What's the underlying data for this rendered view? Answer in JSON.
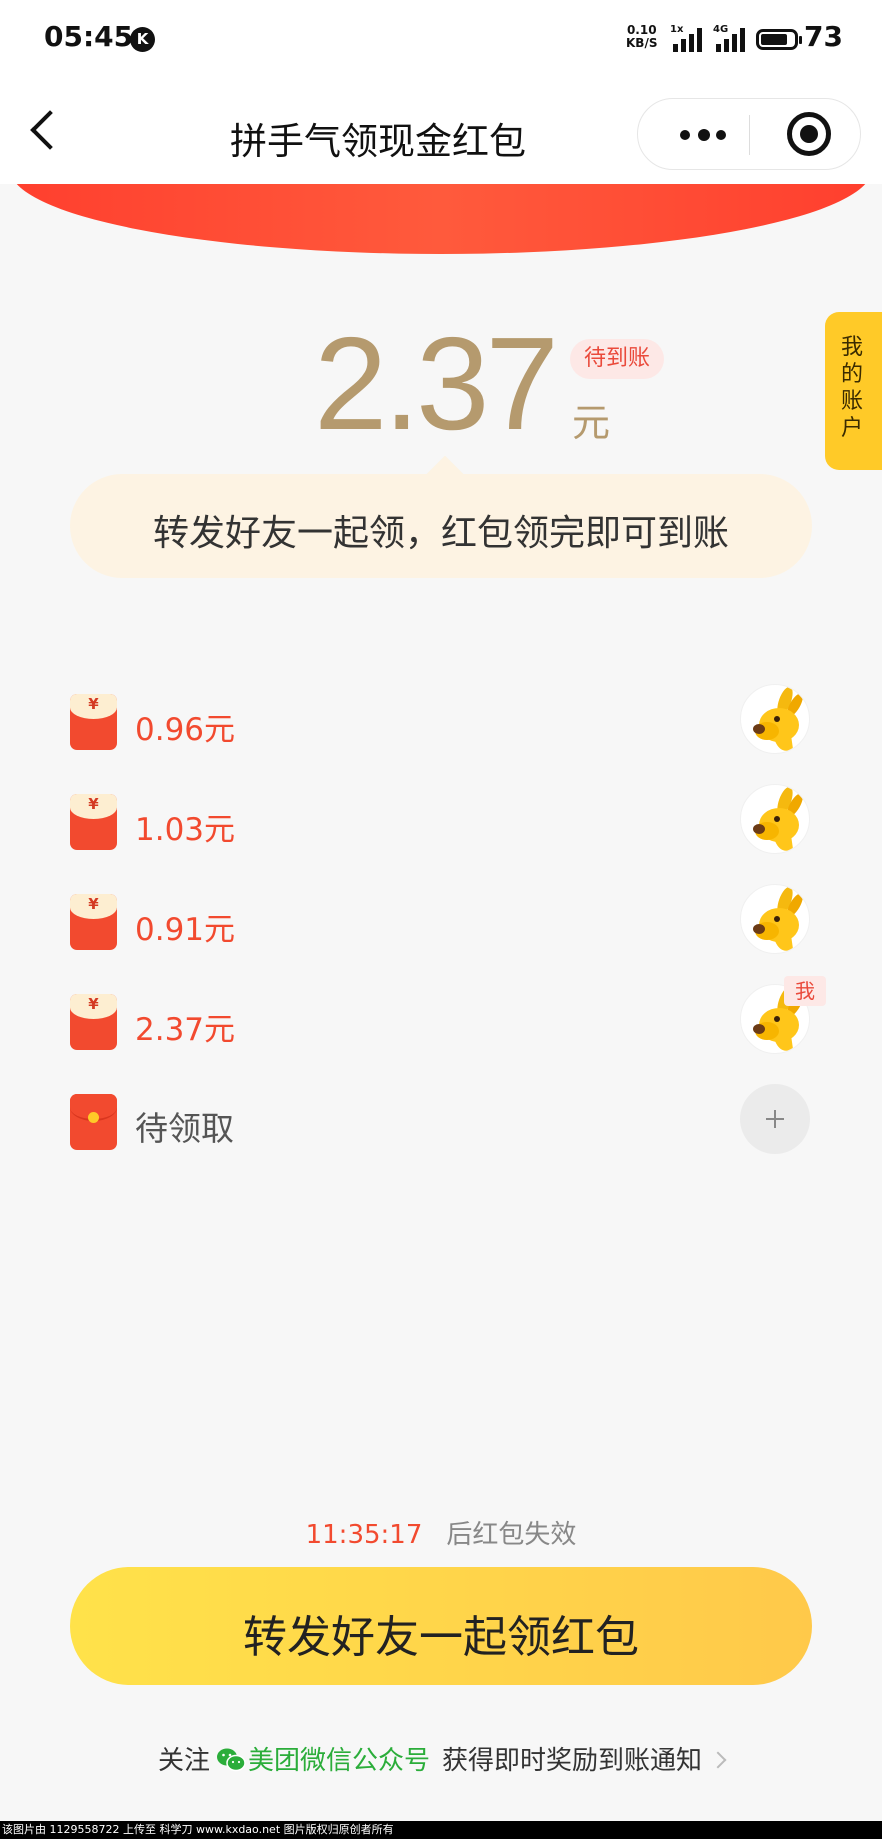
{
  "status_bar": {
    "time": "05:45",
    "k_badge": "K",
    "net_speed_value": "0.10",
    "net_speed_unit": "KB/S",
    "net_label_1": "1x",
    "net_label_2": "4G",
    "battery": "73"
  },
  "navbar": {
    "title": "拼手气领现金红包"
  },
  "summary": {
    "amount": "2.37",
    "unit": "元",
    "status_badge": "待到账",
    "tip": "转发好友一起领，红包领完即可到账"
  },
  "side_tab": {
    "label": "我的账户"
  },
  "packets": [
    {
      "amount": "0.96元",
      "currency_symbol": "¥"
    },
    {
      "amount": "1.03元",
      "currency_symbol": "¥"
    },
    {
      "amount": "0.91元",
      "currency_symbol": "¥"
    },
    {
      "amount": "2.37元",
      "currency_symbol": "¥",
      "badge": "我"
    }
  ],
  "pending_slot": {
    "label": "待领取"
  },
  "countdown": {
    "time": "11:35:17",
    "text": "后红包失效"
  },
  "share_button": {
    "label": "转发好友一起领红包"
  },
  "follow": {
    "prefix": "关注",
    "link": "美团微信公众号",
    "suffix": "获得即时奖励到账通知"
  },
  "footer": {
    "text": "该图片由 1129558722 上传至 科学刀 www.kxdao.net 图片版权归原创者所有"
  },
  "colors": {
    "accent_red": "#f24a2f",
    "gold": "#b59a6e",
    "button_yellow": "#ffd84a",
    "wechat_green": "#2bad3a"
  }
}
